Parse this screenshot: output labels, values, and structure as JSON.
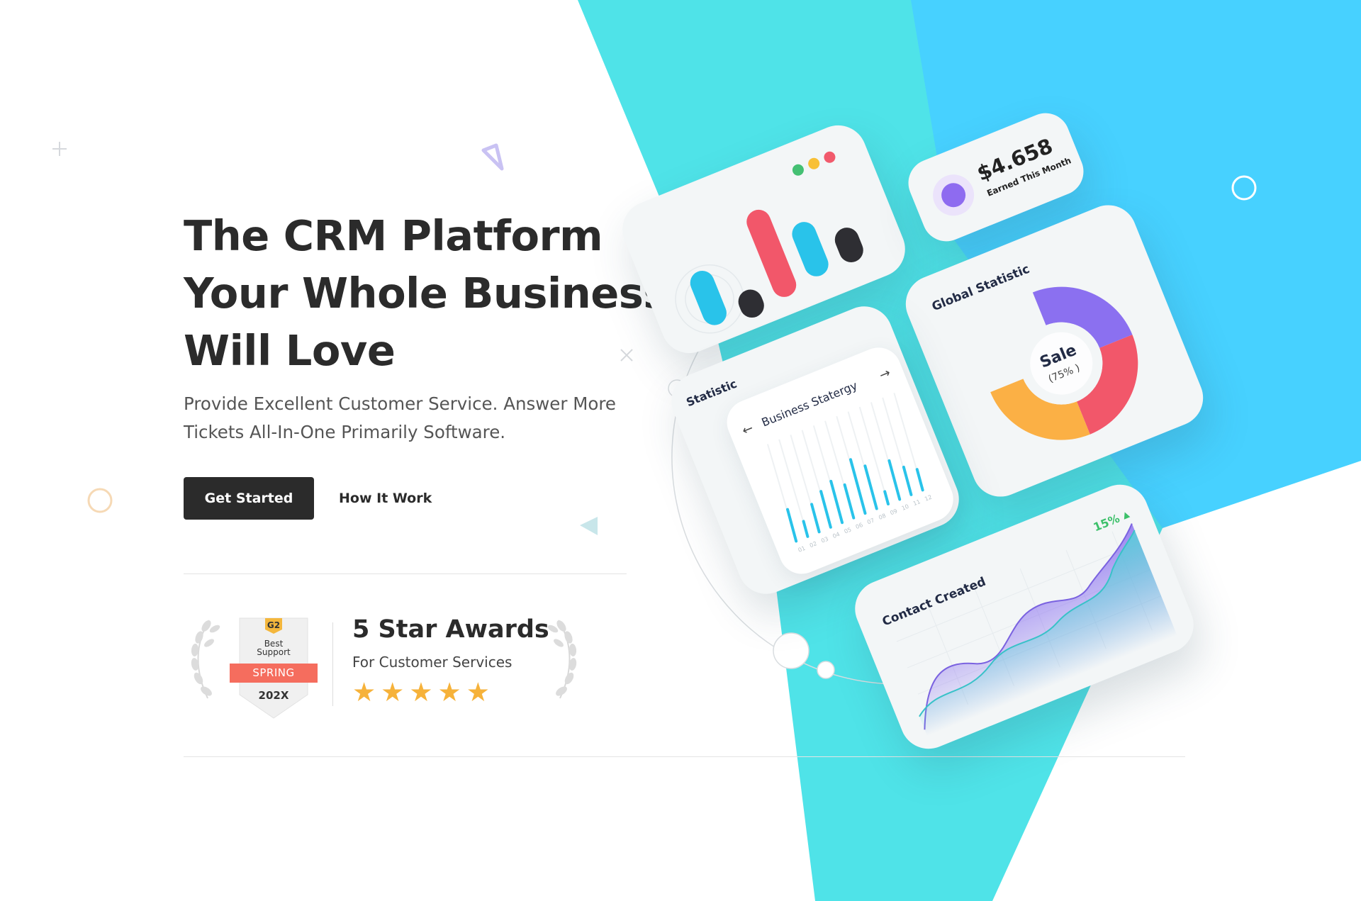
{
  "hero": {
    "title_line1": "The CRM Platform",
    "title_line2": "Your Whole Business",
    "title_line3": "Will Love",
    "subtitle_line1": "Provide Excellent Customer Service. Answer More",
    "subtitle_line2": "Tickets All-In-One Primarily Software.",
    "primary_button": "Get Started",
    "secondary_link": "How It Work"
  },
  "award": {
    "badge_brand": "G2",
    "badge_line1": "Best",
    "badge_line2": "Support",
    "badge_season": "SPRING",
    "badge_year": "202X",
    "title": "5 Star Awards",
    "subtitle": "For Customer Services",
    "stars": 5
  },
  "dashboard": {
    "earnings_value": "$4.658",
    "earnings_label": "Earned This Month",
    "global_statistic_title": "Global Statistic",
    "donut_center_label": "Sale",
    "donut_center_value": "(75% )",
    "statistic_title": "Statistic",
    "strategy_title": "Business Statergy",
    "strategy_x_labels": [
      "01",
      "02",
      "03",
      "04",
      "05",
      "06",
      "07",
      "08",
      "09",
      "10",
      "11",
      "12"
    ],
    "contact_title": "Contact Created",
    "contact_change": "15%"
  },
  "colors": {
    "accent_dark": "#2b2b2b",
    "bg_cyan": "#4fe3e8",
    "bg_blue": "#47d1ff",
    "chart_blue": "#29c3ea",
    "chart_red": "#f2576a",
    "positive_green": "#3cc06a",
    "star": "#f6b23a"
  },
  "icons": {
    "window_dots": "traffic-light-dots-icon",
    "arrow_left": "arrow-left-icon",
    "arrow_right": "arrow-right-icon",
    "trend_up": "triangle-up-icon",
    "laurel": "laurel-wreath-icon",
    "star": "star-icon"
  }
}
